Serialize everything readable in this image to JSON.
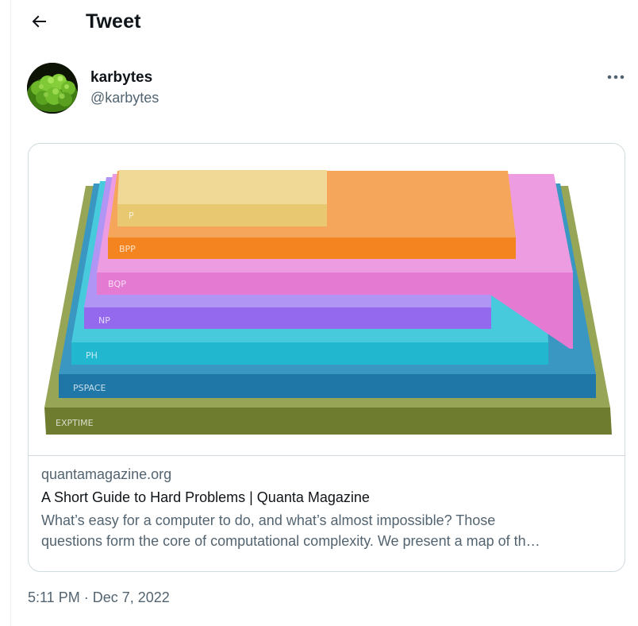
{
  "header": {
    "back_icon": "arrow-left-icon",
    "title": "Tweet"
  },
  "author": {
    "display_name": "karbytes",
    "handle": "@karbytes",
    "avatar_icon": "avatar-broccoli-image"
  },
  "more_icon": "more-horizontal-icon",
  "link_card": {
    "image": {
      "layers": [
        "EXPTIME",
        "PSPACE",
        "PH",
        "NP",
        "BQP",
        "BPP",
        "P"
      ],
      "colors": {
        "EXPTIME": "#7a8a3a",
        "PSPACE": "#2a86b5",
        "PH": "#26bcd4",
        "NP": "#9b72ee",
        "BQP": "#e87fd6",
        "BPP": "#f49138",
        "P": "#eccf80"
      }
    },
    "domain": "quantamagazine.org",
    "title": "A Short Guide to Hard Problems | Quanta Magazine",
    "description_line1": "What’s easy for a computer to do, and what’s almost impossible? Those",
    "description_line2": "questions form the core of computational complexity. We present a map of th…"
  },
  "timestamp": {
    "time": "5:11 PM",
    "separator": " · ",
    "date": "Dec 7, 2022"
  },
  "colors": {
    "text_primary": "#0f1419",
    "text_secondary": "#536471",
    "border": "#cfd9de"
  }
}
